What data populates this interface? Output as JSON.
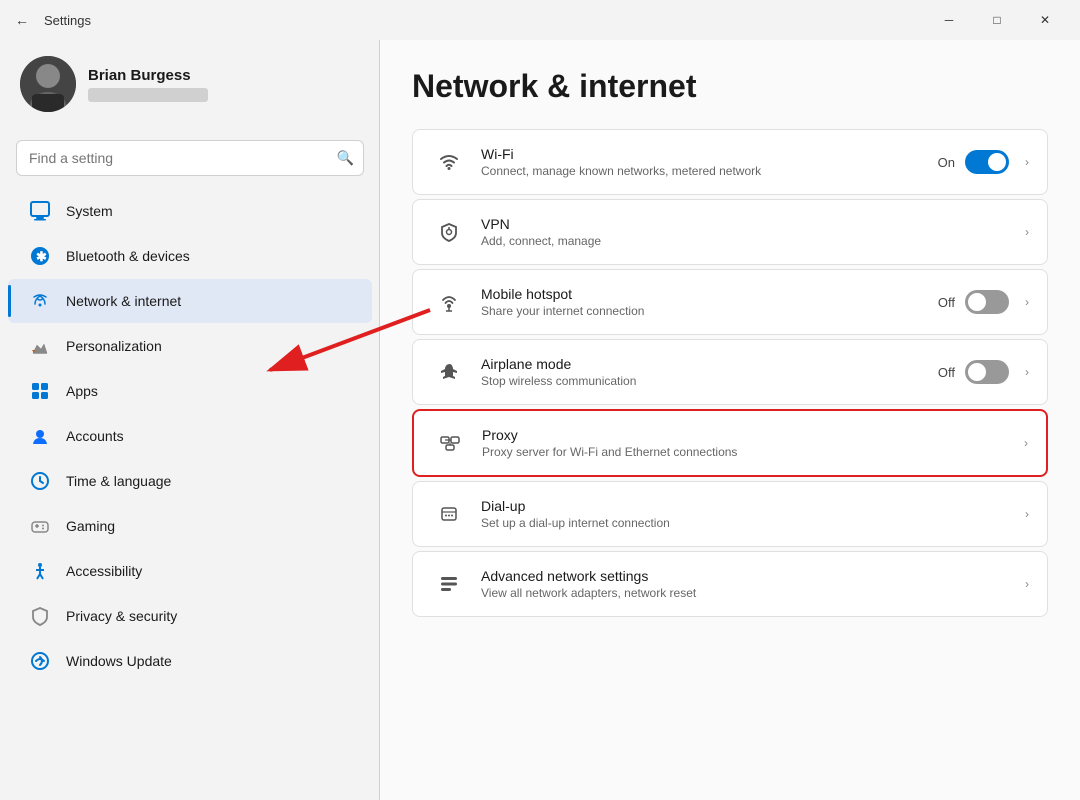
{
  "titleBar": {
    "title": "Settings",
    "backBtn": "←",
    "minimizeBtn": "─",
    "maximizeBtn": "□",
    "closeBtn": "✕"
  },
  "sidebar": {
    "user": {
      "name": "Brian Burgess"
    },
    "searchPlaceholder": "Find a setting",
    "navItems": [
      {
        "id": "system",
        "label": "System",
        "iconColor": "#0078d4",
        "active": false
      },
      {
        "id": "bluetooth",
        "label": "Bluetooth & devices",
        "iconColor": "#0078d4",
        "active": false
      },
      {
        "id": "network",
        "label": "Network & internet",
        "iconColor": "#0078d4",
        "active": true
      },
      {
        "id": "personalization",
        "label": "Personalization",
        "iconColor": "#555",
        "active": false
      },
      {
        "id": "apps",
        "label": "Apps",
        "iconColor": "#0078d4",
        "active": false
      },
      {
        "id": "accounts",
        "label": "Accounts",
        "iconColor": "#0078d4",
        "active": false
      },
      {
        "id": "time",
        "label": "Time & language",
        "iconColor": "#0078d4",
        "active": false
      },
      {
        "id": "gaming",
        "label": "Gaming",
        "iconColor": "#555",
        "active": false
      },
      {
        "id": "accessibility",
        "label": "Accessibility",
        "iconColor": "#0078d4",
        "active": false
      },
      {
        "id": "privacy",
        "label": "Privacy & security",
        "iconColor": "#555",
        "active": false
      },
      {
        "id": "windows-update",
        "label": "Windows Update",
        "iconColor": "#0078d4",
        "active": false
      }
    ]
  },
  "content": {
    "pageTitle": "Network & internet",
    "settings": [
      {
        "id": "wifi",
        "title": "Wi-Fi",
        "desc": "Connect, manage known networks, metered network",
        "hasToggle": true,
        "toggleState": "on",
        "toggleLabel": "On",
        "hasChevron": true,
        "highlighted": false
      },
      {
        "id": "vpn",
        "title": "VPN",
        "desc": "Add, connect, manage",
        "hasToggle": false,
        "hasChevron": true,
        "highlighted": false
      },
      {
        "id": "mobile-hotspot",
        "title": "Mobile hotspot",
        "desc": "Share your internet connection",
        "hasToggle": true,
        "toggleState": "off",
        "toggleLabel": "Off",
        "hasChevron": true,
        "highlighted": false
      },
      {
        "id": "airplane-mode",
        "title": "Airplane mode",
        "desc": "Stop wireless communication",
        "hasToggle": true,
        "toggleState": "off",
        "toggleLabel": "Off",
        "hasChevron": true,
        "highlighted": false
      },
      {
        "id": "proxy",
        "title": "Proxy",
        "desc": "Proxy server for Wi-Fi and Ethernet connections",
        "hasToggle": false,
        "hasChevron": true,
        "highlighted": true
      },
      {
        "id": "dialup",
        "title": "Dial-up",
        "desc": "Set up a dial-up internet connection",
        "hasToggle": false,
        "hasChevron": true,
        "highlighted": false
      },
      {
        "id": "advanced",
        "title": "Advanced network settings",
        "desc": "View all network adapters, network reset",
        "hasToggle": false,
        "hasChevron": true,
        "highlighted": false
      }
    ]
  }
}
